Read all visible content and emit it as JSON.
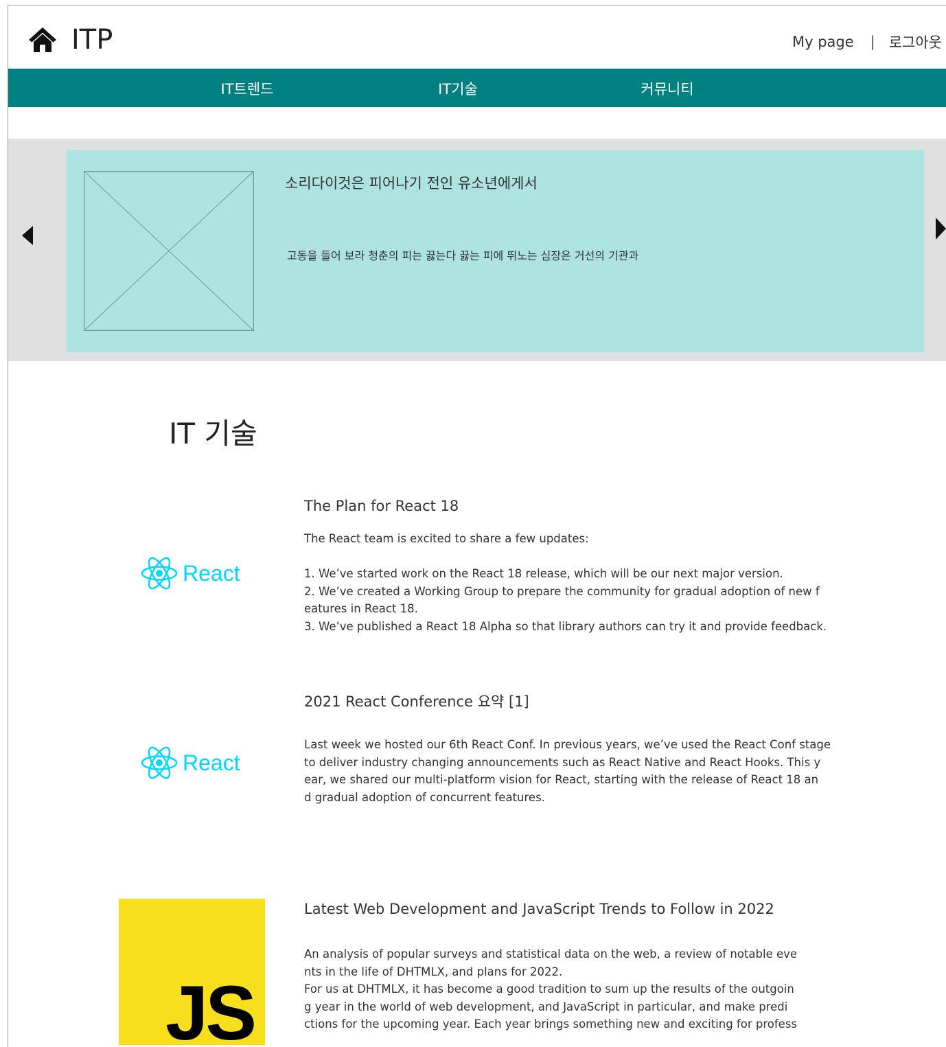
{
  "header": {
    "logo_text": "ITP",
    "home_icon": "home-icon",
    "my_page": "My page",
    "separator": "|",
    "logout": "로그아웃"
  },
  "nav": {
    "items": [
      {
        "label": "IT트렌드"
      },
      {
        "label": "IT기술"
      },
      {
        "label": "커뮤니티"
      }
    ],
    "background": "#008080"
  },
  "banner": {
    "title": "소리다이것은 피어나기 전인 유소년에게서",
    "text": "고동을 들어 보라 청춘의 피는 끓는다 끓는 피에 뛰노는 심장은 거선의 기관과",
    "background": "#ade3e1",
    "prev_icon": "caret-left-icon",
    "next_icon": "caret-right-icon"
  },
  "section": {
    "title": "IT 기술"
  },
  "articles": [
    {
      "logo": "React",
      "title": "The Plan for React 18",
      "lines": [
        "The React team is excited to share a few updates:",
        "",
        "1. We’ve started work on the React 18 release, which will be our next major version.",
        "2. We’ve created a Working Group to prepare the community for gradual adoption of new f",
        "eatures in React 18.",
        "3. We’ve published a React 18 Alpha so that library authors can try it and provide feedback."
      ]
    },
    {
      "logo": "React",
      "title": "2021 React Conference 요약 [1]",
      "lines": [
        "Last week we hosted our 6th React Conf. In previous years, we’ve used the React Conf stage",
        "to deliver industry changing announcements such as React Native and React Hooks. This y",
        "ear, we shared our multi-platform vision for React, starting with the release of React 18 an",
        "d gradual adoption of concurrent features."
      ]
    },
    {
      "logo": "JS",
      "title": "Latest Web Development and JavaScript Trends to Follow in 2022",
      "lines": [
        "An analysis of popular surveys and statistical data on the web, a review of notable eve",
        "nts in the life of DHTMLX, and plans for 2022.",
        "For us at DHTMLX, it has become a good tradition to sum up the results of the outgoin",
        "g year in the world of web development, and JavaScript in particular, and make predi",
        "ctions for the upcoming year. Each year brings something new and exciting for profess"
      ]
    }
  ]
}
